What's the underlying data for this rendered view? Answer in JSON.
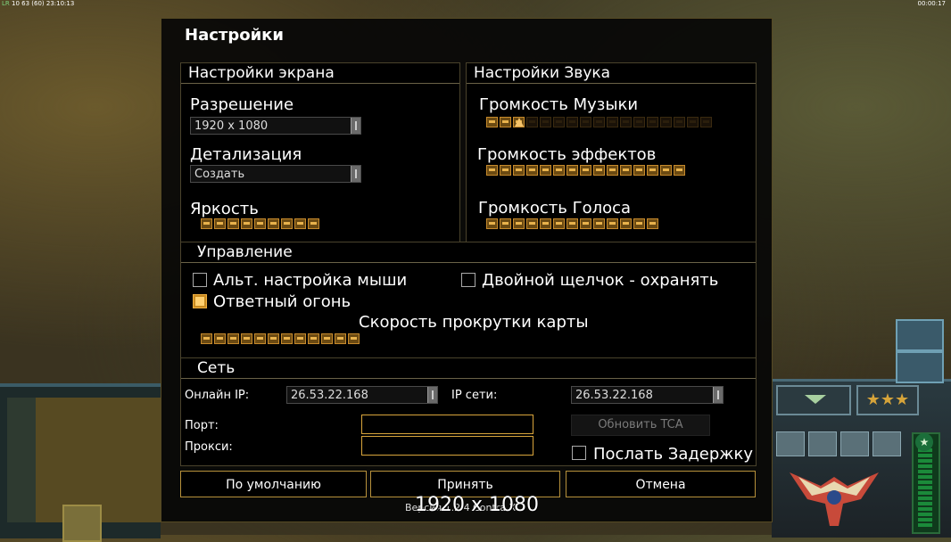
{
  "hud": {
    "top_left_prefix": "LR",
    "top_left_stats": "10 63 (60) 23:10:13",
    "top_right_time": "00:00:17"
  },
  "dialog": {
    "title": "Настройки"
  },
  "display": {
    "header": "Настройки экрана",
    "resolution_label": "Разрешение",
    "resolution_value": "1920 x 1080",
    "detail_label": "Детализация",
    "detail_value": "Создать",
    "brightness_label": "Яркость",
    "brightness_level": 9,
    "brightness_max": 9
  },
  "sound": {
    "header": "Настройки Звука",
    "music_label": "Громкость Музыки",
    "music_level": 3,
    "music_max": 17,
    "effects_label": "Громкость эффектов",
    "effects_level": 15,
    "effects_max": 15,
    "voice_label": "Громкость Голоса",
    "voice_level": 13,
    "voice_max": 13
  },
  "control": {
    "header": "Управление",
    "alt_mouse_label": "Альт. настройка мыши",
    "alt_mouse_checked": false,
    "double_click_label": "Двойной щелчок - охранять",
    "double_click_checked": false,
    "return_fire_label": "Ответный огонь",
    "return_fire_checked": true,
    "scroll_speed_label": "Скорость прокрутки карты",
    "scroll_speed_level": 12,
    "scroll_speed_max": 12
  },
  "network": {
    "header": "Сеть",
    "online_ip_label": "Онлайн IP:",
    "online_ip_value": "26.53.22.168",
    "lan_ip_label": "IP сети:",
    "lan_ip_value": "26.53.22.168",
    "port_label": "Порт:",
    "port_value": "",
    "proxy_label": "Прокси:",
    "proxy_value": "",
    "refresh_tca_label": "Обновить TCA",
    "send_delay_label": "Послать Задержку",
    "send_delay_checked": false
  },
  "buttons": {
    "defaults": "По умолчанию",
    "accept": "Принять",
    "cancel": "Отмена"
  },
  "footer": {
    "version_text": "Версия 1.2.4 Contra X",
    "overlay_resolution": "1920 x 1080"
  },
  "colors": {
    "accent_gold": "#d9a53c",
    "slider_on": "#c68a2c",
    "panel_border": "#4a432c"
  }
}
